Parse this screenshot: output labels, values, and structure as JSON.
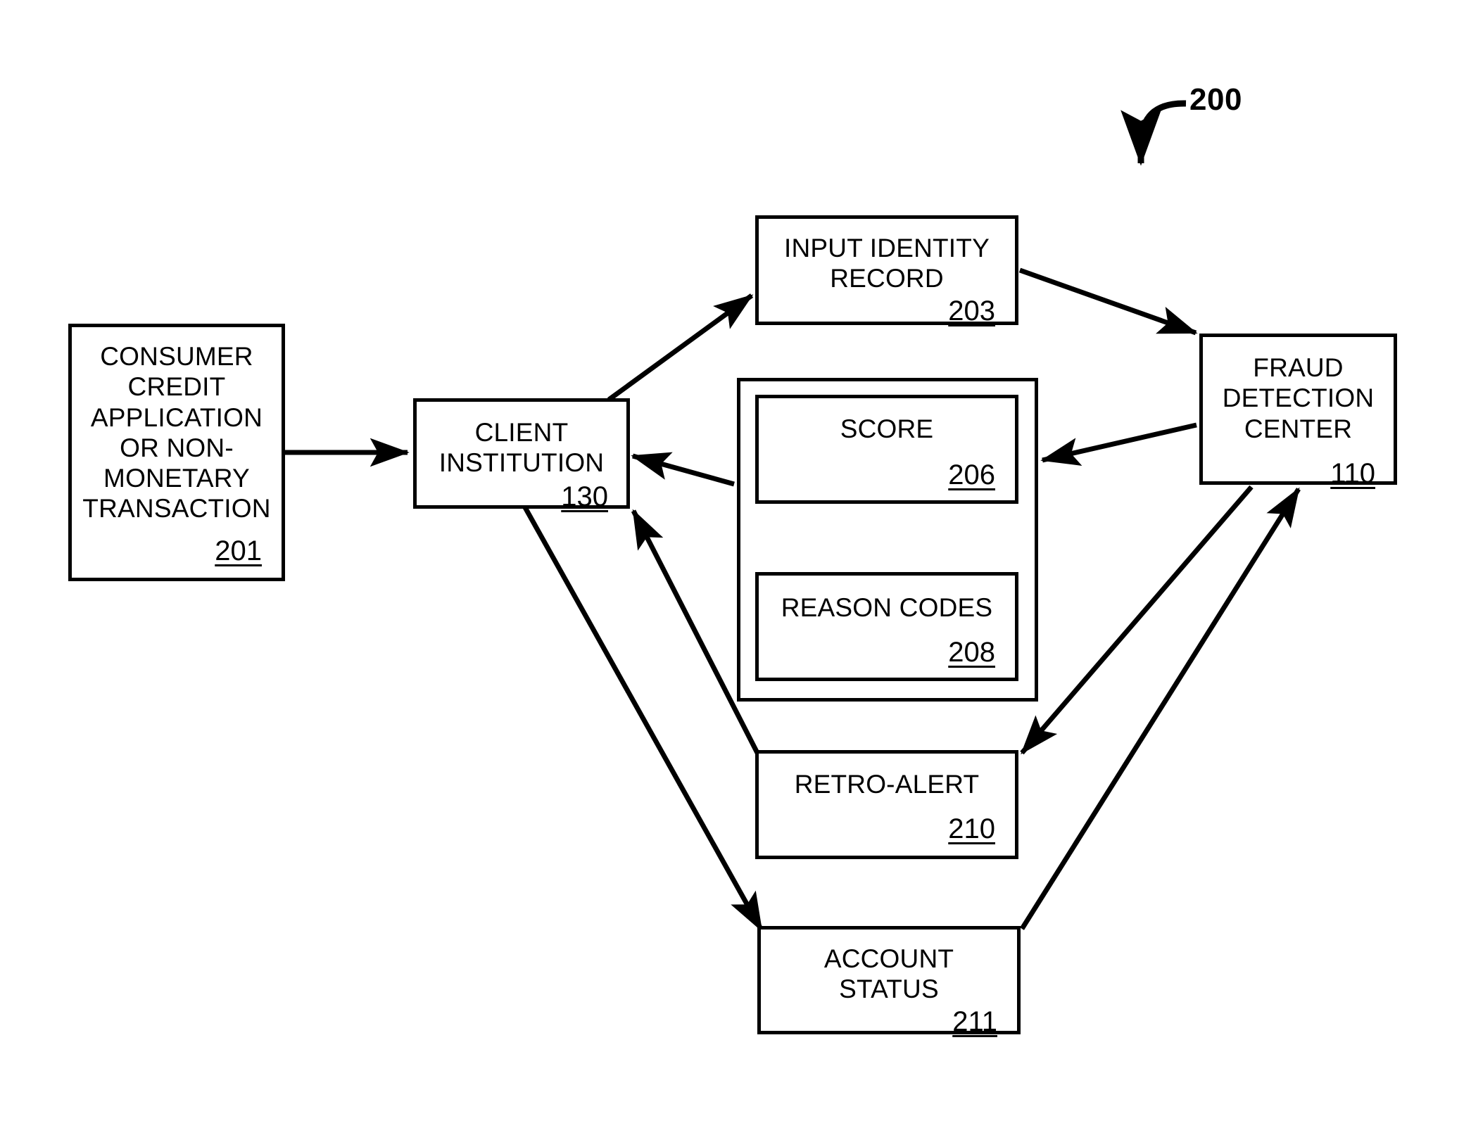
{
  "figure": {
    "reference_numeral": "200",
    "line_color": "#000000",
    "background_color": "#ffffff"
  },
  "nodes": [
    {
      "id": "201",
      "title": "CONSUMER\nCREDIT\nAPPLICATION\nOR NON-\nMONETARY\nTRANSACTION",
      "ref": "201"
    },
    {
      "id": "130",
      "title": "CLIENT\nINSTITUTION",
      "ref": "130"
    },
    {
      "id": "203",
      "title": "INPUT IDENTITY\nRECORD",
      "ref": "203"
    },
    {
      "id": "110",
      "title": "FRAUD\nDETECTION\nCENTER",
      "ref": "110"
    },
    {
      "id": "206",
      "title": "SCORE",
      "ref": "206"
    },
    {
      "id": "208",
      "title": "REASON CODES",
      "ref": "208"
    },
    {
      "id": "210",
      "title": "RETRO-ALERT",
      "ref": "210"
    },
    {
      "id": "211",
      "title": "ACCOUNT\nSTATUS",
      "ref": "211"
    }
  ],
  "connections": [
    {
      "from": "201",
      "to": "130",
      "style": "straight-arrow"
    },
    {
      "from": "130",
      "to": "203",
      "style": "diagonal-arrow"
    },
    {
      "from": "203",
      "to": "110",
      "style": "diagonal-arrow"
    },
    {
      "from": "110",
      "to": "score-reason-group",
      "style": "diagonal-arrow"
    },
    {
      "from": "score-reason-group",
      "to": "130",
      "style": "diagonal-arrow"
    },
    {
      "from": "130",
      "to": "211",
      "style": "diagonal-arrow"
    },
    {
      "from": "210",
      "to": "130",
      "style": "diagonal-arrow"
    },
    {
      "from": "110",
      "to": "210",
      "style": "diagonal-arrow"
    },
    {
      "from": "211",
      "to": "110",
      "style": "diagonal-arrow"
    }
  ]
}
